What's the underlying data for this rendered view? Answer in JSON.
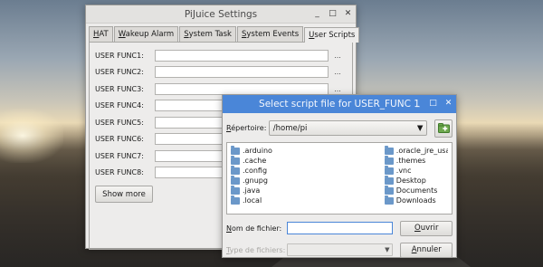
{
  "main_window": {
    "title": "PiJuice Settings",
    "tabs": [
      {
        "prefix": "",
        "mnemonic": "H",
        "rest": "AT"
      },
      {
        "prefix": "",
        "mnemonic": "W",
        "rest": "akeup Alarm"
      },
      {
        "prefix": "",
        "mnemonic": "S",
        "rest": "ystem Task"
      },
      {
        "prefix": "",
        "mnemonic": "S",
        "rest": "ystem Events"
      },
      {
        "prefix": "",
        "mnemonic": "U",
        "rest": "ser Scripts"
      }
    ],
    "active_tab_index": 4,
    "funcs": [
      {
        "label": "USER FUNC1:",
        "value": ""
      },
      {
        "label": "USER FUNC2:",
        "value": ""
      },
      {
        "label": "USER FUNC3:",
        "value": ""
      },
      {
        "label": "USER FUNC4:",
        "value": ""
      },
      {
        "label": "USER FUNC5:",
        "value": ""
      },
      {
        "label": "USER FUNC6:",
        "value": ""
      },
      {
        "label": "USER FUNC7:",
        "value": ""
      },
      {
        "label": "USER FUNC8:",
        "value": ""
      }
    ],
    "browse_label": "...",
    "show_more_label": "Show more"
  },
  "dialog": {
    "title": "Select script file for USER_FUNC 1",
    "dir_label": "Répertoire:",
    "dir_label_mnemonic": "R",
    "dir_label_rest": "épertoire:",
    "dir_value": "/home/pi",
    "files_col1": [
      ".arduino",
      ".cache",
      ".config",
      ".gnupg",
      ".java",
      ".local"
    ],
    "files_col2": [
      ".oracle_jre_usa",
      ".themes",
      ".vnc",
      "Desktop",
      "Documents",
      "Downloads"
    ],
    "filename_label_mnemonic": "N",
    "filename_label_rest": "om de fichier:",
    "filename_value": "",
    "filetype_label_mnemonic": "T",
    "filetype_label_rest": "ype de fichiers:",
    "open_mnemonic": "O",
    "open_rest": "uvrir",
    "cancel_mnemonic": "A",
    "cancel_rest": "nnuler"
  },
  "window_buttons": {
    "minimize": "_",
    "maximize": "□",
    "close": "✕"
  },
  "colors": {
    "dialog_titlebar": "#4a86d8",
    "folder_icon": "#6b98c9"
  }
}
